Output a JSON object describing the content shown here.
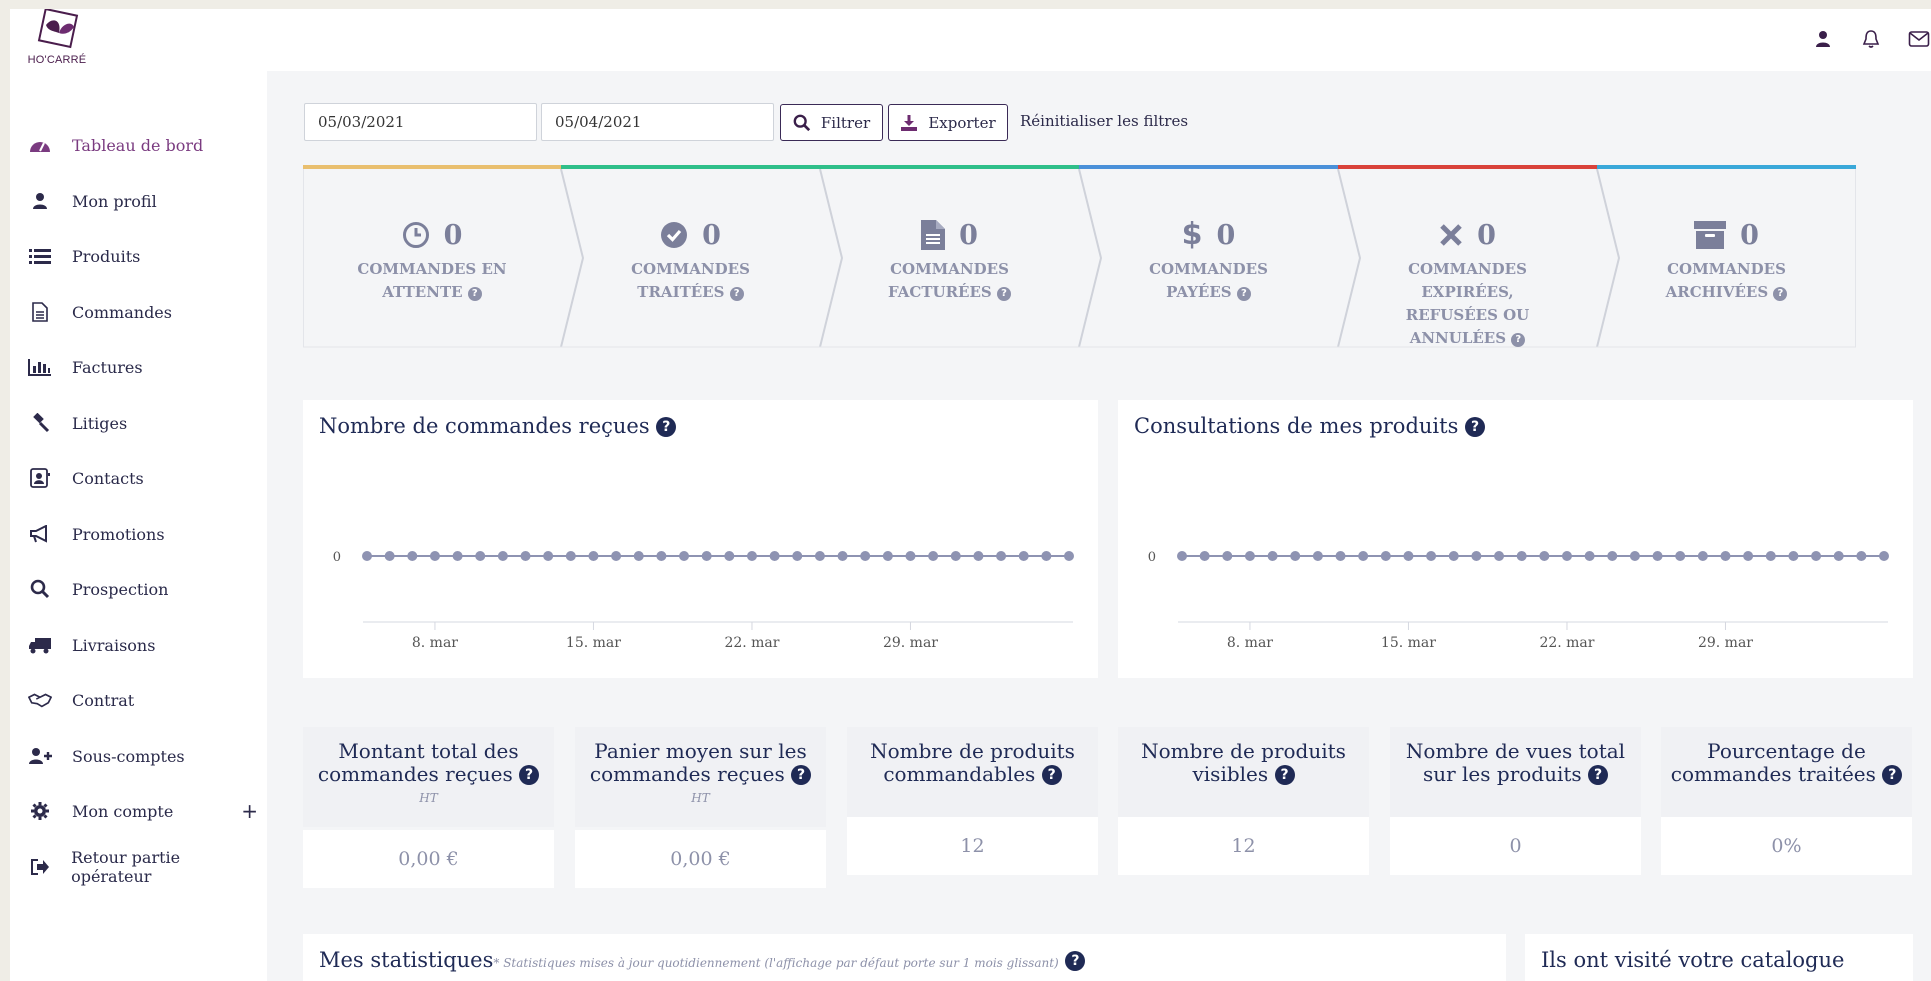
{
  "brand": {
    "logo_text": "HO'CARRÉ"
  },
  "topbar": {
    "icons": [
      "user-icon",
      "bell-icon",
      "envelope-icon"
    ]
  },
  "sidebar": {
    "items": [
      {
        "label": "Tableau de bord",
        "icon": "dashboard-icon",
        "active": true
      },
      {
        "label": "Mon profil",
        "icon": "user-icon"
      },
      {
        "label": "Produits",
        "icon": "list-icon"
      },
      {
        "label": "Commandes",
        "icon": "document-icon"
      },
      {
        "label": "Factures",
        "icon": "bar-chart-icon"
      },
      {
        "label": "Litiges",
        "icon": "gavel-icon"
      },
      {
        "label": "Contacts",
        "icon": "contact-card-icon"
      },
      {
        "label": "Promotions",
        "icon": "megaphone-icon"
      },
      {
        "label": "Prospection",
        "icon": "search-icon"
      },
      {
        "label": "Livraisons",
        "icon": "truck-icon"
      },
      {
        "label": "Contrat",
        "icon": "handshake-icon"
      },
      {
        "label": "Sous-comptes",
        "icon": "user-plus-icon"
      },
      {
        "label": "Mon compte",
        "icon": "gear-icon",
        "expand": "+"
      },
      {
        "label": "Retour partie opérateur",
        "icon": "sign-out-icon"
      }
    ]
  },
  "filters": {
    "date_from": "05/03/2021",
    "date_to": "05/04/2021",
    "filter_label": "Filtrer",
    "export_label": "Exporter",
    "reset_label": "Réinitialiser les filtres"
  },
  "statuses": [
    {
      "count": "0",
      "label_line1": "COMMANDES EN",
      "label_line2": "ATTENTE",
      "icon": "clock-icon",
      "color": "#e9bf6f"
    },
    {
      "count": "0",
      "label_line1": "COMMANDES",
      "label_line2": "TRAITÉES",
      "icon": "check-circle-icon",
      "color": "#2fbf8a"
    },
    {
      "count": "0",
      "label_line1": "COMMANDES",
      "label_line2": "FACTURÉES",
      "icon": "invoice-icon",
      "color": "#2fbf8a"
    },
    {
      "count": "0",
      "label_line1": "COMMANDES",
      "label_line2": "PAYÉES",
      "icon": "dollar-icon",
      "color": "#4a90d9"
    },
    {
      "count": "0",
      "label_line1": "COMMANDES",
      "label_line2": "EXPIRÉES,",
      "label_line3": "REFUSÉES OU",
      "label_line4": "ANNULÉES",
      "icon": "times-icon",
      "color": "#d9423a"
    },
    {
      "count": "0",
      "label_line1": "COMMANDES",
      "label_line2": "ARCHIVÉES",
      "icon": "archive-icon",
      "color": "#39a8d9"
    }
  ],
  "chart_data": [
    {
      "type": "line",
      "title": "Nombre de commandes reçues",
      "x": [
        "2021-03-05",
        "2021-03-06",
        "2021-03-07",
        "2021-03-08",
        "2021-03-09",
        "2021-03-10",
        "2021-03-11",
        "2021-03-12",
        "2021-03-13",
        "2021-03-14",
        "2021-03-15",
        "2021-03-16",
        "2021-03-17",
        "2021-03-18",
        "2021-03-19",
        "2021-03-20",
        "2021-03-21",
        "2021-03-22",
        "2021-03-23",
        "2021-03-24",
        "2021-03-25",
        "2021-03-26",
        "2021-03-27",
        "2021-03-28",
        "2021-03-29",
        "2021-03-30",
        "2021-03-31",
        "2021-04-01",
        "2021-04-02",
        "2021-04-03",
        "2021-04-04",
        "2021-04-05"
      ],
      "values": [
        0,
        0,
        0,
        0,
        0,
        0,
        0,
        0,
        0,
        0,
        0,
        0,
        0,
        0,
        0,
        0,
        0,
        0,
        0,
        0,
        0,
        0,
        0,
        0,
        0,
        0,
        0,
        0,
        0,
        0,
        0,
        0
      ],
      "x_ticks": [
        "8. mar",
        "15. mar",
        "22. mar",
        "29. mar"
      ],
      "y_ticks": [
        "0"
      ],
      "color": "#8e93b2"
    },
    {
      "type": "line",
      "title": "Consultations de mes produits",
      "x": [
        "2021-03-05",
        "2021-03-06",
        "2021-03-07",
        "2021-03-08",
        "2021-03-09",
        "2021-03-10",
        "2021-03-11",
        "2021-03-12",
        "2021-03-13",
        "2021-03-14",
        "2021-03-15",
        "2021-03-16",
        "2021-03-17",
        "2021-03-18",
        "2021-03-19",
        "2021-03-20",
        "2021-03-21",
        "2021-03-22",
        "2021-03-23",
        "2021-03-24",
        "2021-03-25",
        "2021-03-26",
        "2021-03-27",
        "2021-03-28",
        "2021-03-29",
        "2021-03-30",
        "2021-03-31",
        "2021-04-01",
        "2021-04-02",
        "2021-04-03",
        "2021-04-04",
        "2021-04-05"
      ],
      "values": [
        0,
        0,
        0,
        0,
        0,
        0,
        0,
        0,
        0,
        0,
        0,
        0,
        0,
        0,
        0,
        0,
        0,
        0,
        0,
        0,
        0,
        0,
        0,
        0,
        0,
        0,
        0,
        0,
        0,
        0,
        0,
        0
      ],
      "x_ticks": [
        "8. mar",
        "15. mar",
        "22. mar",
        "29. mar"
      ],
      "y_ticks": [
        "0"
      ],
      "color": "#8e93b2"
    }
  ],
  "kpis": [
    {
      "line1": "Montant total des",
      "line2": "commandes reçues",
      "sub": "HT",
      "value": "0,00 €"
    },
    {
      "line1": "Panier moyen sur les",
      "line2": "commandes reçues",
      "sub": "HT",
      "value": "0,00 €"
    },
    {
      "line1": "Nombre de produits",
      "line2": "commandables",
      "sub": "",
      "value": "12"
    },
    {
      "line1": "Nombre de produits",
      "line2": "visibles",
      "sub": "",
      "value": "12"
    },
    {
      "line1": "Nombre de vues total",
      "line2": "sur les produits",
      "sub": "",
      "value": "0"
    },
    {
      "line1": "Pourcentage de",
      "line2": "commandes traitées",
      "sub": "",
      "value": "0%"
    }
  ],
  "bottom": {
    "stats_title": "Mes statistiques",
    "stats_note": "* Statistiques mises à jour quotidiennement (l'affichage par défaut porte sur 1 mois glissant)",
    "visitors_title": "Ils ont visité votre catalogue"
  }
}
